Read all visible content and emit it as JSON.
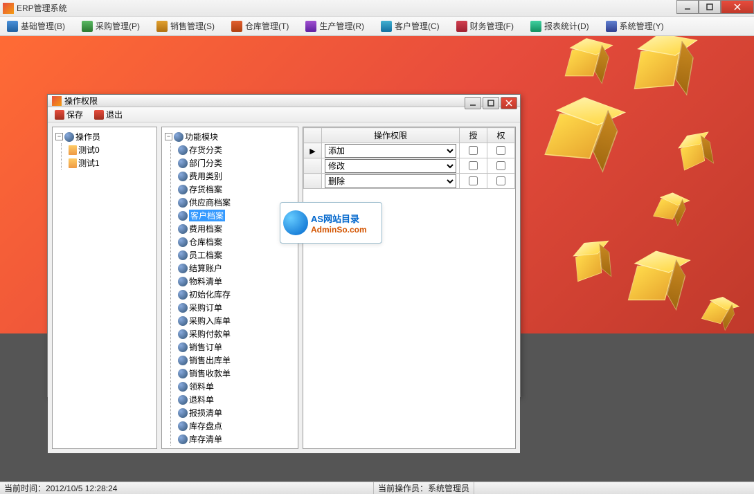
{
  "main_window": {
    "title": "ERP管理系统"
  },
  "menu": [
    {
      "icon": "mi-user",
      "label": "基础管理(B)"
    },
    {
      "icon": "mi-cart",
      "label": "采购管理(P)"
    },
    {
      "icon": "mi-sale",
      "label": "销售管理(S)"
    },
    {
      "icon": "mi-wh",
      "label": "仓库管理(T)"
    },
    {
      "icon": "mi-prod",
      "label": "生产管理(R)"
    },
    {
      "icon": "mi-cust",
      "label": "客户管理(C)"
    },
    {
      "icon": "mi-fin",
      "label": "财务管理(F)"
    },
    {
      "icon": "mi-rep",
      "label": "报表统计(D)"
    },
    {
      "icon": "mi-sys",
      "label": "系统管理(Y)"
    }
  ],
  "dialog": {
    "title": "操作权限",
    "toolbar": {
      "save": "保存",
      "exit": "退出"
    }
  },
  "tree_left": {
    "root": "操作员",
    "children": [
      "测试0",
      "测试1"
    ]
  },
  "tree_mid": {
    "root": "功能模块",
    "children": [
      "存货分类",
      "部门分类",
      "费用类别",
      "存货档案",
      "供应商档案",
      "客户档案",
      "费用档案",
      "仓库档案",
      "员工档案",
      "结算账户",
      "物料清单",
      "初始化库存",
      "采购订单",
      "采购入库单",
      "采购付款单",
      "销售订单",
      "销售出库单",
      "销售收款单",
      "领料单",
      "退料单",
      "报损清单",
      "库存盘点",
      "库存清单"
    ],
    "selected_index": 5
  },
  "grid": {
    "headers": {
      "perm": "操作权限",
      "grant": "授",
      "deny": "权"
    },
    "rows": [
      {
        "perm": "添加",
        "grant": false,
        "deny": false,
        "current": true
      },
      {
        "perm": "修改",
        "grant": false,
        "deny": false,
        "current": false
      },
      {
        "perm": "删除",
        "grant": false,
        "deny": false,
        "current": false
      }
    ]
  },
  "watermark": {
    "line1": "AS网站目录",
    "line2": "AdminSo.com"
  },
  "status": {
    "time_label": "当前时间：",
    "time_value": "2012/10/5 12:28:24",
    "user_label": "当前操作员：",
    "user_value": "系统管理员"
  }
}
